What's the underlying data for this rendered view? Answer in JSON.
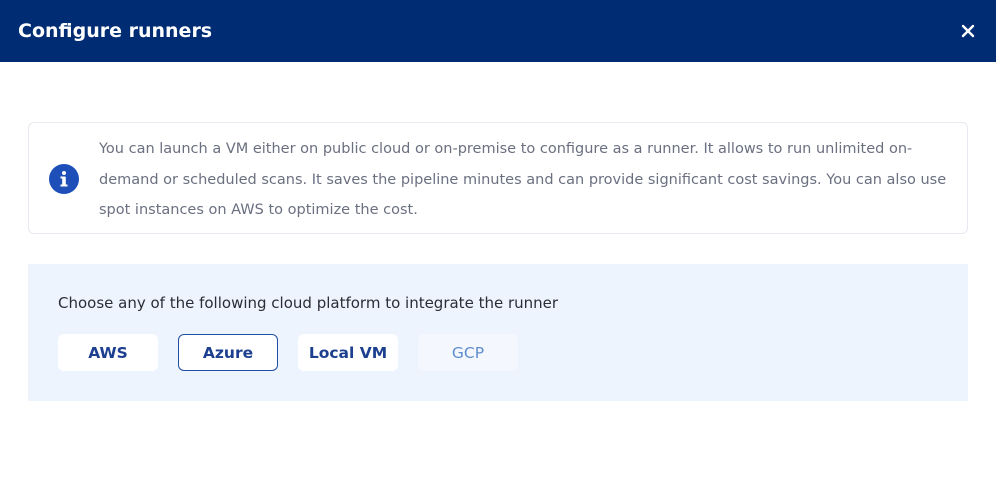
{
  "modal": {
    "title": "Configure runners",
    "close_icon": "close-icon"
  },
  "info": {
    "icon": "info-icon",
    "text": "You can launch a VM either on public cloud or on-premise to configure as a runner. It allows to run unlimited on-demand or scheduled scans. It saves the pipeline minutes and can provide significant cost savings. You can also use spot instances on AWS to optimize the cost."
  },
  "platforms": {
    "label": "Choose any of the following cloud platform to integrate the runner",
    "options": [
      {
        "label": "AWS",
        "state": "default"
      },
      {
        "label": "Azure",
        "state": "selected"
      },
      {
        "label": "Local VM",
        "state": "default"
      },
      {
        "label": "GCP",
        "state": "disabled"
      }
    ]
  },
  "colors": {
    "header_bg": "#002c73",
    "panel_bg": "#eef4fd",
    "accent": "#1f4ea3",
    "info_icon": "#1e4fb8"
  }
}
